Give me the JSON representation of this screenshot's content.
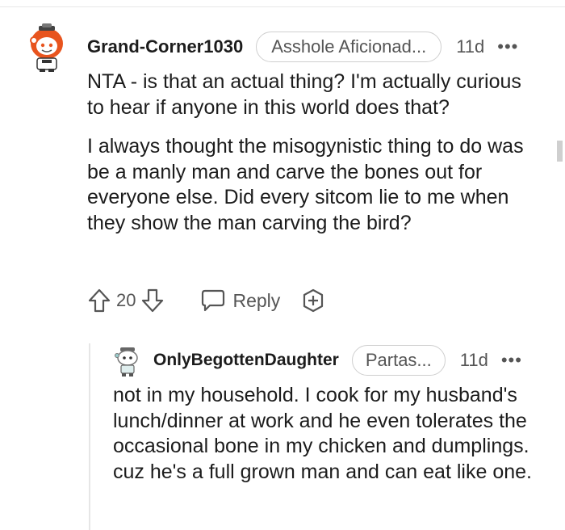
{
  "comments": [
    {
      "username": "Grand-Corner1030",
      "flair": "Asshole Aficionad...",
      "time": "11d",
      "more": "•••",
      "paragraphs": [
        "NTA - is that an actual thing? I'm actually curious to hear if anyone in this world does that?",
        "I always thought the misogynistic thing to do was be a manly man and carve the bones out for everyone else. Did every sitcom lie to me when they show the man carving the bird?"
      ],
      "score": "20",
      "reply_label": "Reply"
    },
    {
      "username": "OnlyBegottenDaughter",
      "flair": "Partas...",
      "time": "11d",
      "more": "•••",
      "paragraphs": [
        "not in my household. I cook for my husband's lunch/dinner at work and he even tolerates the occasional bone in my chicken and dumplings. cuz he's a full grown man and can eat like one."
      ]
    }
  ],
  "icons": {
    "upvote": "upvote-icon",
    "downvote": "downvote-icon",
    "reply": "reply-bubble-icon",
    "award": "award-icon",
    "more": "more-options-icon"
  },
  "colors": {
    "text": "#1c1c1c",
    "meta": "#555555",
    "avatar_orange": "#e8541e"
  }
}
